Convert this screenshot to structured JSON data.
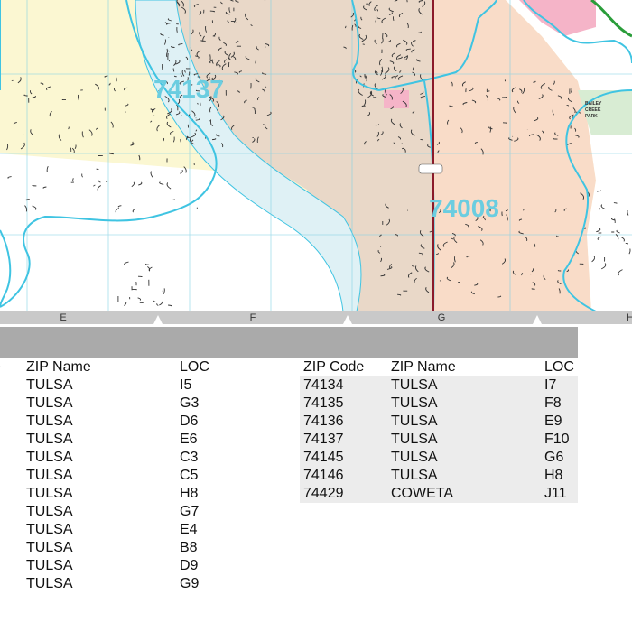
{
  "map": {
    "zip_labels": [
      "74137",
      "74008"
    ],
    "park_label": [
      "BAILEY",
      "CREEK",
      "PARK"
    ],
    "colors": {
      "zone_yellow": "#fbf7d2",
      "zone_tan": "#e9d8c8",
      "zone_peach": "#f9dcc8",
      "zone_white": "#ffffff",
      "river": "#dff1f5",
      "boundary": "#3fc4e2",
      "highway": "#8b1a2a",
      "parkway": "#2a9d3a",
      "park_green": "#d8ecd3",
      "pink": "#f5b4c8",
      "grid": "#7fd0e4"
    }
  },
  "grid_columns": [
    "E",
    "F",
    "G",
    "H"
  ],
  "table_left": {
    "headers": [
      "e",
      "ZIP Name",
      "LOC"
    ],
    "rows": [
      [
        "TULSA",
        "I5"
      ],
      [
        "TULSA",
        "G3"
      ],
      [
        "TULSA",
        "D6"
      ],
      [
        "TULSA",
        "E6"
      ],
      [
        "TULSA",
        "C3"
      ],
      [
        "TULSA",
        "C5"
      ],
      [
        "TULSA",
        "H8"
      ],
      [
        "TULSA",
        "G7"
      ],
      [
        "TULSA",
        "E4"
      ],
      [
        "TULSA",
        "B8"
      ],
      [
        "TULSA",
        "D9"
      ],
      [
        "TULSA",
        "G9"
      ]
    ]
  },
  "table_right": {
    "headers": [
      "ZIP Code",
      "ZIP Name",
      "LOC"
    ],
    "rows": [
      [
        "74134",
        "TULSA",
        "I7"
      ],
      [
        "74135",
        "TULSA",
        "F8"
      ],
      [
        "74136",
        "TULSA",
        "E9"
      ],
      [
        "74137",
        "TULSA",
        "F10"
      ],
      [
        "74145",
        "TULSA",
        "G6"
      ],
      [
        "74146",
        "TULSA",
        "H8"
      ],
      [
        "74429",
        "COWETA",
        "J11"
      ]
    ]
  }
}
